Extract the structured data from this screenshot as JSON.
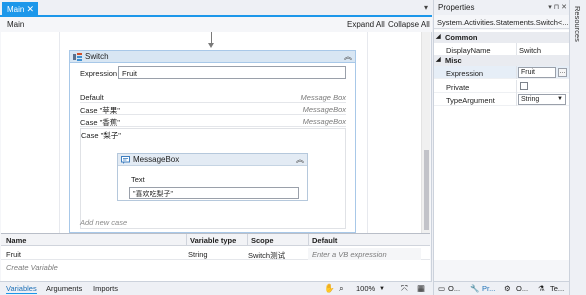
{
  "designer": {
    "tab_label": "Main",
    "tab_close": "✕",
    "title": "Main",
    "expand_all": "Expand All",
    "collapse_all": "Collapse All"
  },
  "switch_activity": {
    "title": "Switch",
    "expression_label": "Expression",
    "expression_value": "Fruit",
    "default_label": "Default",
    "default_value": "Message Box",
    "cases": [
      {
        "label": "Case \"苹果\"",
        "value": "MessageBox"
      },
      {
        "label": "Case \"香蕉\"",
        "value": "MessageBox"
      }
    ],
    "open_case_label": "Case \"梨子\"",
    "add_new_case": "Add new case"
  },
  "message_box": {
    "title": "MessageBox",
    "text_label": "Text",
    "text_value": "\"喜欢吃梨子\""
  },
  "variables": {
    "columns": [
      "Name",
      "Variable type",
      "Scope",
      "Default"
    ],
    "rows": [
      {
        "name": "Fruit",
        "type": "String",
        "scope": "Switch测试",
        "default_placeholder": "Enter a VB expression"
      }
    ],
    "create_variable": "Create Variable"
  },
  "bottom_tabs": {
    "variables": "Variables",
    "arguments": "Arguments",
    "imports": "Imports",
    "zoom": "100%"
  },
  "properties": {
    "title": "Properties",
    "pins": "▾ ⊓ ✕",
    "type_name": "System.Activities.Statements.Switch<...",
    "categories": {
      "common": "Common",
      "misc": "Misc"
    },
    "display_name_label": "DisplayName",
    "display_name_value": "Switch",
    "expression_label": "Expression",
    "expression_value": "Fruit",
    "private_label": "Private",
    "type_argument_label": "TypeArgument",
    "type_argument_value": "String",
    "bottom_tabs": [
      "O...",
      "Pr...",
      "O...",
      "Te..."
    ]
  },
  "side_strip": {
    "label": "Resources"
  },
  "colors": {
    "accent": "#1c97ea",
    "switch_header": "#d8e6f3",
    "message_header": "#e3ebf4"
  }
}
